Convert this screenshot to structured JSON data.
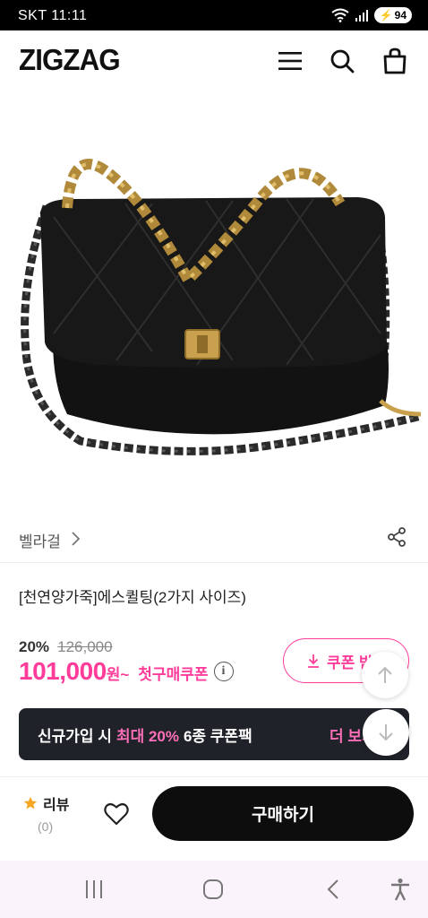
{
  "status_bar": {
    "carrier_time": "SKT 11:11",
    "battery": "94"
  },
  "header": {
    "logo": "ZIGZAG"
  },
  "product": {
    "brand": "벨라걸",
    "title": "[천연양가죽]에스퀼팅(2가지 사이즈)",
    "discount_rate": "20%",
    "original_price": "126,000",
    "sale_price": "101,000",
    "sale_unit": "원~",
    "coupon_text": "첫구매쿠폰",
    "coupon_button": "쿠폰 받기"
  },
  "banner": {
    "prefix": "신규가입 시",
    "highlight": "최대 20%",
    "suffix": "6종 쿠폰팩",
    "more": "더 보기"
  },
  "bottom_bar": {
    "review_label": "리뷰",
    "review_count": "(0)",
    "buy_button": "구매하기"
  },
  "colors": {
    "accent": "#ff3c9a",
    "banner_bg": "#1f2229",
    "buy_bg": "#0d0d0d",
    "star": "#f5a623"
  }
}
